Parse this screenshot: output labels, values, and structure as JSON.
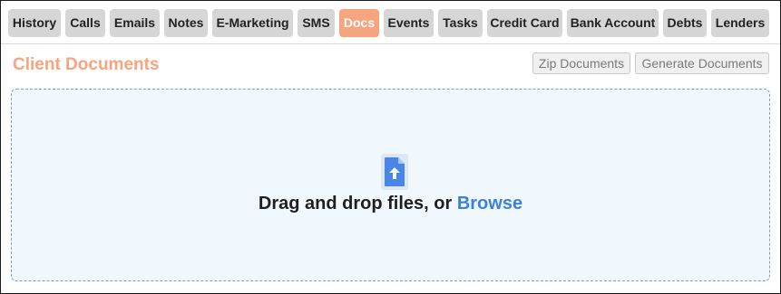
{
  "tabs": [
    {
      "label": "History",
      "active": false
    },
    {
      "label": "Calls",
      "active": false
    },
    {
      "label": "Emails",
      "active": false
    },
    {
      "label": "Notes",
      "active": false
    },
    {
      "label": "E-Marketing",
      "active": false
    },
    {
      "label": "SMS",
      "active": false
    },
    {
      "label": "Docs",
      "active": true
    },
    {
      "label": "Events",
      "active": false
    },
    {
      "label": "Tasks",
      "active": false
    },
    {
      "label": "Credit Card",
      "active": false
    },
    {
      "label": "Bank Account",
      "active": false
    },
    {
      "label": "Debts",
      "active": false
    },
    {
      "label": "Lenders",
      "active": false
    }
  ],
  "section": {
    "title": "Client Documents",
    "zip_label": "Zip Documents",
    "generate_label": "Generate Documents"
  },
  "dropzone": {
    "icon": "file-upload-icon",
    "text": "Drag and drop files, or ",
    "browse_label": "Browse"
  },
  "colors": {
    "accent": "#f6a57f",
    "tab_bg": "#d6d6d6",
    "link": "#3b82d6",
    "dropzone_bg": "#f0f7fd",
    "icon_blue": "#4a86e8"
  }
}
